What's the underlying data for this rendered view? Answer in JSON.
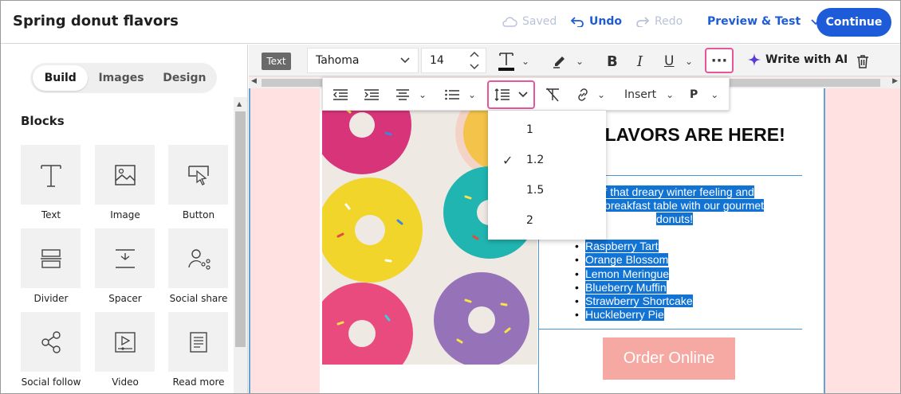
{
  "doc": {
    "title": "Spring donut flavors"
  },
  "topbar": {
    "saved": "Saved",
    "undo": "Undo",
    "redo": "Redo",
    "preview": "Preview & Test",
    "continue": "Continue"
  },
  "left": {
    "tabs": [
      "Build",
      "Images",
      "Design"
    ],
    "blocks_title": "Blocks",
    "blocks": [
      {
        "label": "Text",
        "icon": "text-icon"
      },
      {
        "label": "Image",
        "icon": "image-icon"
      },
      {
        "label": "Button",
        "icon": "button-icon"
      },
      {
        "label": "Divider",
        "icon": "divider-icon"
      },
      {
        "label": "Spacer",
        "icon": "spacer-icon"
      },
      {
        "label": "Social share",
        "icon": "social-share-icon"
      },
      {
        "label": "Social follow",
        "icon": "social-follow-icon"
      },
      {
        "label": "Video",
        "icon": "video-icon"
      },
      {
        "label": "Read more",
        "icon": "read-more-icon"
      }
    ]
  },
  "toolbar": {
    "tag": "Text",
    "font": "Tahoma",
    "size": "14",
    "write_ai": "Write with AI",
    "bold": "B",
    "italic": "I",
    "underline": "U",
    "insert": "Insert",
    "paragraph": "P"
  },
  "line_height": {
    "options": [
      "1",
      "1.2",
      "1.5",
      "2"
    ],
    "selected": "1.2"
  },
  "email": {
    "heading": "ING FLAVORS ARE HERE!",
    "para_lines": [
      "off that dreary winter feeling and",
      "our breakfast table with our gourmet",
      "donuts!"
    ],
    "flavors": [
      "Raspberry Tart",
      "Orange Blossom",
      "Lemon Meringue",
      "Blueberry Muffin",
      "Strawberry Shortcake",
      "Huckleberry Pie"
    ],
    "button": "Order Online"
  },
  "colors": {
    "accent": "#1d5bd9",
    "highlight": "#e8559b",
    "selection": "#1173d4",
    "canvas_bg": "#ffe1e1",
    "button_bg": "#f6a8a3"
  }
}
